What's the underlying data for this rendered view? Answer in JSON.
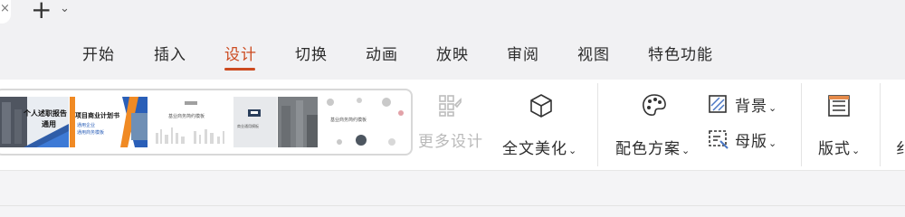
{
  "titlebar": {
    "close_glyph": "×",
    "new_tab_glyph": "+",
    "dropdown_glyph": "⌄"
  },
  "menu": {
    "tabs": [
      {
        "label": "开始"
      },
      {
        "label": "插入"
      },
      {
        "label": "设计"
      },
      {
        "label": "切换"
      },
      {
        "label": "动画"
      },
      {
        "label": "放映"
      },
      {
        "label": "审阅"
      },
      {
        "label": "视图"
      },
      {
        "label": "特色功能"
      }
    ],
    "active_tab": "设计"
  },
  "ribbon": {
    "templates": [
      {
        "lines": [
          "个人述职报告",
          "通用"
        ]
      },
      {
        "lines": [
          "项目商业计划书",
          "通用企业",
          "通用商务模板"
        ]
      },
      {
        "lines": [
          "基业商务简约模板"
        ]
      },
      {
        "lines": [
          "商业通用模板"
        ]
      },
      {
        "lines": []
      },
      {
        "lines": [
          "基业商务简约模板"
        ]
      }
    ],
    "more_designs": {
      "label": "更多设计",
      "disabled": true
    },
    "beautify": {
      "label": "全文美化",
      "chevron": "⌄"
    },
    "color_scheme": {
      "label": "配色方案",
      "chevron": "⌄"
    },
    "background": {
      "label": "背景",
      "chevron": "⌄"
    },
    "master": {
      "label": "母版",
      "chevron": "⌄"
    },
    "layout": {
      "label": "版式",
      "chevron": "⌄"
    },
    "next_group_partial": {
      "label": "纟"
    }
  },
  "colors": {
    "accent": "#cc4a1f",
    "disabled_text": "#b9b9b9"
  }
}
